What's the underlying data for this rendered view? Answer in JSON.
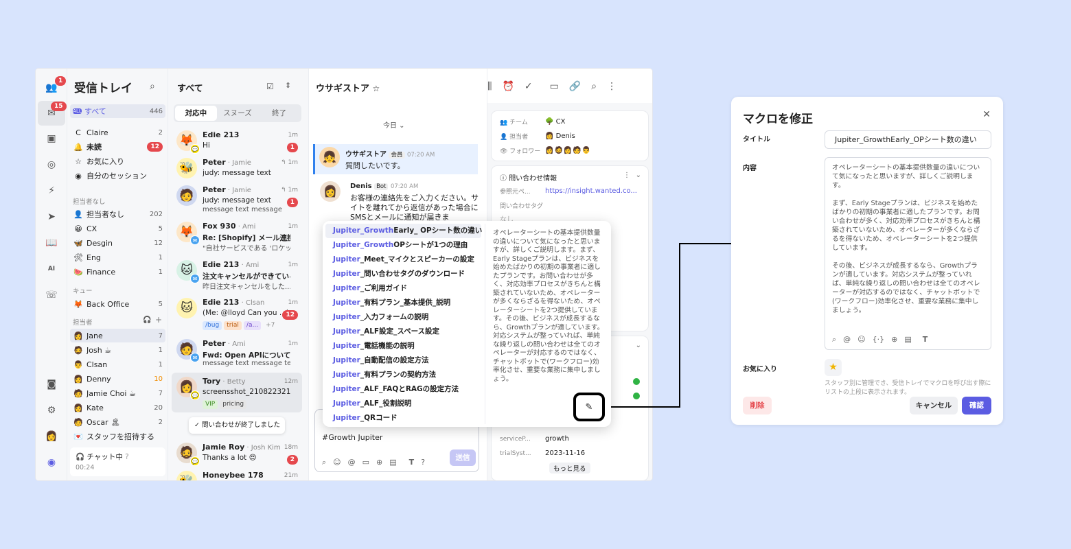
{
  "rail": {
    "team_badge": "1",
    "inbox_badge": "15"
  },
  "inbox": {
    "title": "受信トレイ",
    "all": {
      "label": "すべて",
      "count": "446"
    },
    "personal": [
      {
        "label": "Claire",
        "count": "2",
        "icon": "C"
      },
      {
        "label": "未読",
        "count": "12",
        "icon": "🔔"
      },
      {
        "label": "お気に入り",
        "count": "",
        "icon": "☆"
      },
      {
        "label": "自分のセッション",
        "count": "",
        "icon": "◉"
      }
    ],
    "unassigned_section": "担当者なし",
    "teams": [
      {
        "label": "担当者なし",
        "count": "202",
        "icon": "👤"
      },
      {
        "label": "CX",
        "count": "5",
        "icon": "😀"
      },
      {
        "label": "Desgin",
        "count": "12",
        "icon": "🦋"
      },
      {
        "label": "Eng",
        "count": "1",
        "icon": "🛠"
      },
      {
        "label": "Finance",
        "count": "1",
        "icon": "🍉"
      }
    ],
    "queue_section": "キュー",
    "queue": [
      {
        "label": "Back Office",
        "count": "5",
        "icon": "🦊"
      }
    ],
    "assignee_section": "担当者",
    "assignees": [
      {
        "label": "Jane",
        "count": "7"
      },
      {
        "label": "Josh ☕",
        "count": "1"
      },
      {
        "label": "Clsan",
        "count": "1"
      },
      {
        "label": "Denny",
        "count": "10"
      },
      {
        "label": "Jamie Choi ☕",
        "count": "7"
      },
      {
        "label": "Kate",
        "count": "20"
      },
      {
        "label": "Oscar 🏝",
        "count": "2"
      }
    ],
    "invite": "スタッフを招待する",
    "chat_status": "チャット中",
    "chat_time": "00:24"
  },
  "list": {
    "title": "すべて",
    "tabs": [
      "対応中",
      "スヌーズ",
      "終了"
    ],
    "items": [
      {
        "name": "Edie 213",
        "sub": "",
        "time": "1m",
        "l1": "Hi",
        "l2": "",
        "badge": "1",
        "emoji": "🦊"
      },
      {
        "name": "Peter",
        "sub": " · Jamie",
        "time": "1m",
        "l1": "judy: message text",
        "l2": "",
        "badge": "",
        "emoji": "🐝"
      },
      {
        "name": "Peter",
        "sub": " · Jamie",
        "time": "1m",
        "l1": "judy: message text",
        "l2": "message text message",
        "badge": "1",
        "emoji": "🧑"
      },
      {
        "name": "Fox 930",
        "sub": " · Ami",
        "time": "1m",
        "l1": "Re: [Shopify] メール連携につ",
        "l2": "\"自社サービスである 'ロケッ",
        "badge": "",
        "emoji": "🦊"
      },
      {
        "name": "Edie 213",
        "sub": " · Ami",
        "time": "1m",
        "l1": "注文キャンセルができている",
        "l2": "昨日注文キャンセルをした...",
        "badge": "",
        "emoji": "🐱"
      },
      {
        "name": "Edie 213",
        "sub": " · Clsan",
        "time": "1m",
        "l1": "(Me: @lloyd Can you ...)",
        "l2": "",
        "badge": "12",
        "emoji": "🐱"
      },
      {
        "name": "Peter",
        "sub": " · Ami",
        "time": "1m",
        "l1": "Fwd: Open APIについて",
        "l2": "message text message tex...",
        "badge": "",
        "emoji": "🧑"
      },
      {
        "name": "Tory",
        "sub": " · Betty",
        "time": "12m",
        "l1": "screensshot_210822321...",
        "l2": "",
        "badge": "",
        "emoji": "👩"
      }
    ],
    "tags_a": [
      "/bug",
      "trial",
      "/a...",
      "+7"
    ],
    "tags_b": [
      "VIP",
      "pricing"
    ],
    "toast": "問い合わせが終了しました",
    "jamie": {
      "name": "Jamie Roy",
      "sub": " · Josh Kim",
      "time": "18m",
      "l1": "Thanks a lot 😍",
      "badge": "2"
    },
    "honey": {
      "name": "Honeybee 178",
      "time": "21m"
    }
  },
  "chat": {
    "title": "ウサギストア",
    "date": "今日",
    "msg1": {
      "name": "ウサギストア",
      "role": "会員",
      "time": "07:20 AM",
      "text": "質問したいです。"
    },
    "msg2": {
      "name": "Denis",
      "role": "Bot",
      "time": "07:20 AM",
      "text": "お客様の連絡先をご入力ください。サイトを離れてから返信があった場合にSMSとメールに通知が届きま"
    },
    "composer": "#Growth Jupiter",
    "send": "送信"
  },
  "info": {
    "team_k": "チーム",
    "team_v": "CX",
    "assignee_k": "担当者",
    "assignee_v": "Denis",
    "follower_k": "フォロワー",
    "section": "問い合わせ情報",
    "ref_k": "参照元ペ...",
    "ref_v": "https://insight.wanted.co...",
    "tag_k": "問い合わせタグ",
    "tag_v": "なし",
    "svc_k": "serviceP...",
    "svc_v": "growth",
    "trial_k": "trialSyst...",
    "trial_v": "2023-11-16",
    "more": "もっと見る"
  },
  "macro": {
    "items": [
      {
        "h": "Jupiter_Growth",
        "r": "Early_ OPシート数の違い"
      },
      {
        "h": "Jupiter_Growth",
        "r": "OPシートが1つの理由"
      },
      {
        "h": "Jupiter",
        "r": "_Meet_マイクとスピーカーの設定"
      },
      {
        "h": "Jupiter",
        "r": "_問い合わせタグのダウンロード"
      },
      {
        "h": "Jupiter",
        "r": "_ご利用ガイド"
      },
      {
        "h": "Jupiter",
        "r": "_有料プラン_基本提供_説明"
      },
      {
        "h": "Jupiter",
        "r": "_入力フォームの説明"
      },
      {
        "h": "Jupiter",
        "r": "_ALF設定_スペース設定"
      },
      {
        "h": "Jupiter",
        "r": "_電話機能の説明"
      },
      {
        "h": "Jupiter",
        "r": "_自動配信の設定方法"
      },
      {
        "h": "Jupiter",
        "r": "_有料プランの契約方法"
      },
      {
        "h": "Jupiter",
        "r": "_ALF_FAQとRAGの設定方法"
      },
      {
        "h": "Jupiter",
        "r": "_ALF_役割説明"
      },
      {
        "h": "Jupiter",
        "r": "_QRコード"
      }
    ],
    "preview": "オペレーターシートの基本提供数量の違いについて気になったと思いますが、詳しくご説明します。まず、Early Stageプランは、ビジネスを始めたばかりの初期の事業者に適したプランです。お問い合わせが多く、対応効率プロセスがきちんと構築されていないため、オペレーターが多くならざるを得ないため、オペレーターシートを2つ提供しています。その後、ビジネスが成長するなら、Growthプランが適しています。対応システムが整っていれば、単純な繰り返しの問い合わせは全てのオペレーターが対応するのではなく、チャットボットで(ワークフロー)効率化させ、重要な業務に集中しましょう。"
  },
  "modal": {
    "title": "マクロを修正",
    "title_label": "タイトル",
    "title_value": "Jupiter_GrowthEarly_OPシート数の違い",
    "content_label": "内容",
    "content_p1": "オペレーターシートの基本提供数量の違いについて気になったと思いますが、詳しくご説明します。",
    "content_p2": "まず、Early Stageプランは、ビジネスを始めたばかりの初期の事業者に適したプランです。お問い合わせが多く、対応効率プロセスがきちんと構築されていないため、オペレーターが多くならざるを得ないため、オペレーターシートを2つ提供しています。",
    "content_p3": "その後、ビジネスが成長するなら、Growthプランが適しています。対応システムが整っていれば、単純な繰り返しの問い合わせは全てのオペレーターが対応するのではなく、チャットボットで(ワークフロー)効率化させ、重要な業務に集中しましょう。",
    "fav_label": "お気に入り",
    "fav_help": "スタッフ別に管理でき、受信トレイでマクロを呼び出す際にリストの上段に表示されます。",
    "delete": "削除",
    "cancel": "キャンセル",
    "confirm": "確認"
  },
  "colors": {
    "accent": "#5b5ce2",
    "badge": "#e5484d",
    "bg": "#d8e4fd"
  }
}
